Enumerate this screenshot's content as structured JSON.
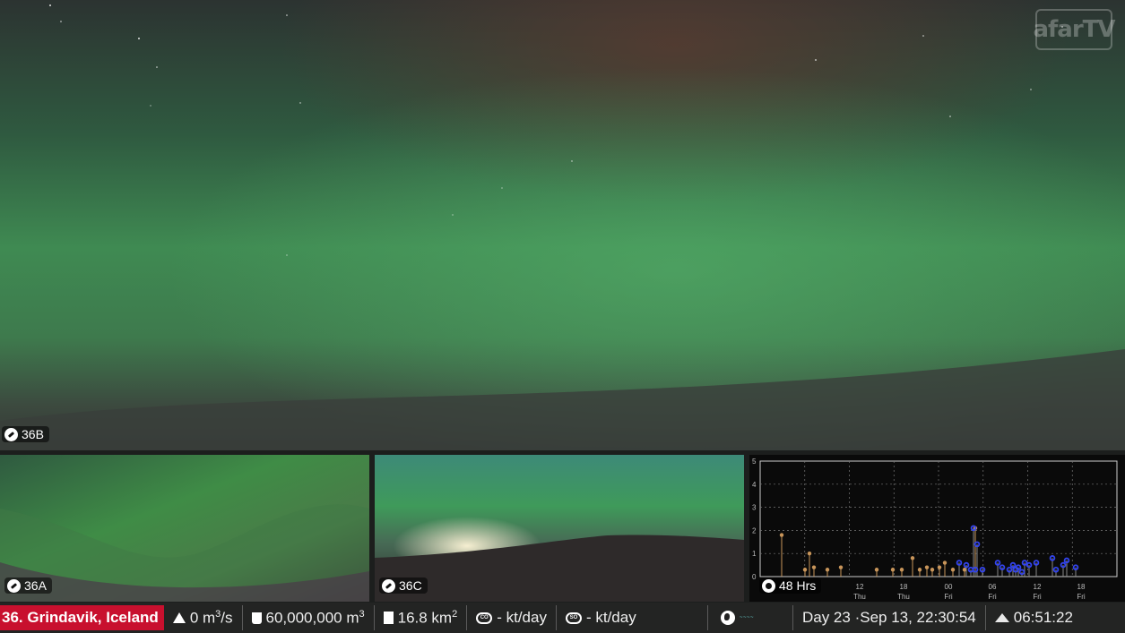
{
  "logo": {
    "text": "afarTV"
  },
  "feeds": {
    "main": {
      "label": "36B"
    },
    "a": {
      "label": "36A"
    },
    "c": {
      "label": "36C"
    }
  },
  "quake_panel": {
    "label": "48 Hrs",
    "y_ticks": [
      "0",
      "1",
      "2",
      "3",
      "4",
      "5"
    ],
    "x_hours": [
      "12",
      "18",
      "00",
      "06",
      "12",
      "18"
    ],
    "x_days": [
      "Thu",
      "Thu",
      "Fri",
      "Fri",
      "Fri",
      "Fri"
    ],
    "colors": {
      "older": "#c8955a",
      "recent": "#3344ee",
      "grid": "#777777"
    }
  },
  "status_bar": {
    "location": "36. Grindavik, Iceland",
    "flow_value": "0 m",
    "flow_unit": "/s",
    "flow_exp": "3",
    "volume_value": "60,000,000 m",
    "volume_exp": "3",
    "area_value": "16.8 km",
    "area_exp": "2",
    "co2_icon": "CO",
    "co2_value": "- kt/day",
    "so2_icon": "SO",
    "so2_value": "- kt/day",
    "day_label": "Day 23",
    "datetime": "Sep 13, 22:30:54",
    "countdown": "06:51:22"
  }
}
